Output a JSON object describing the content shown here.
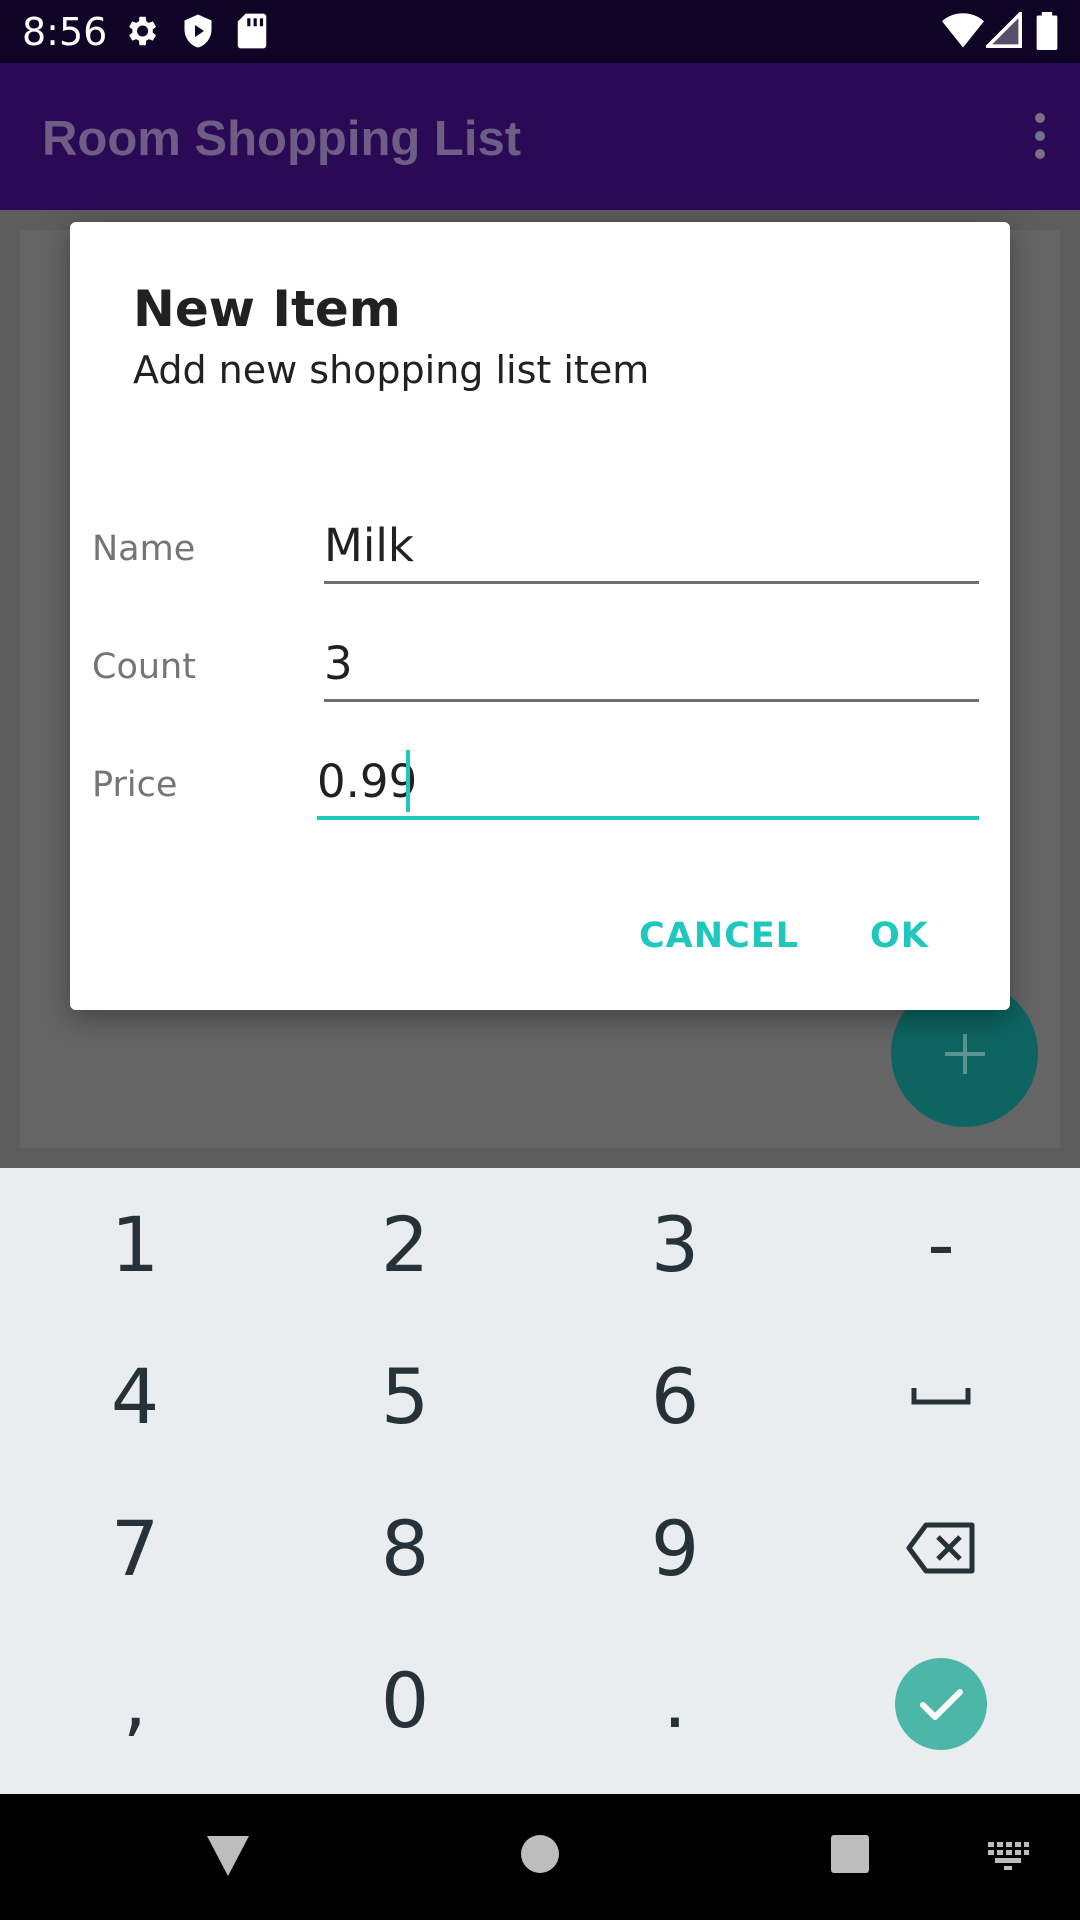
{
  "status_bar": {
    "time": "8:56",
    "icons": [
      "gear-icon",
      "shield-play-icon",
      "sd-card-icon",
      "wifi-icon",
      "signal-icon",
      "battery-icon"
    ]
  },
  "app_bar": {
    "title": "Room Shopping List",
    "menu_icon": "more-vert-icon"
  },
  "dialog": {
    "title": "New Item",
    "subtitle": "Add new shopping list item",
    "fields": [
      {
        "label": "Name",
        "value": "Milk"
      },
      {
        "label": "Count",
        "value": "3"
      },
      {
        "label": "Price",
        "value": "0.99"
      }
    ],
    "cancel_label": "CANCEL",
    "ok_label": "OK"
  },
  "fab": {
    "icon": "plus-icon"
  },
  "keyboard": {
    "rows": [
      [
        "1",
        "2",
        "3",
        "-"
      ],
      [
        "4",
        "5",
        "6",
        ""
      ],
      [
        "7",
        "8",
        "9",
        ""
      ],
      [
        ",",
        "0",
        ".",
        ""
      ]
    ],
    "special_icons": [
      "space-icon",
      "backspace-icon",
      "done-check-icon"
    ]
  },
  "nav_bar": {
    "icons": [
      "back-icon",
      "home-icon",
      "recents-icon",
      "keyboard-switch-icon"
    ]
  },
  "colors": {
    "accent": "#1fc7bd",
    "app_bar": "#2a0a54",
    "status_bar": "#0f0326",
    "fab": "#0d6461",
    "keyboard_bg": "#e9edf0",
    "done_key": "#4cb7a8"
  }
}
